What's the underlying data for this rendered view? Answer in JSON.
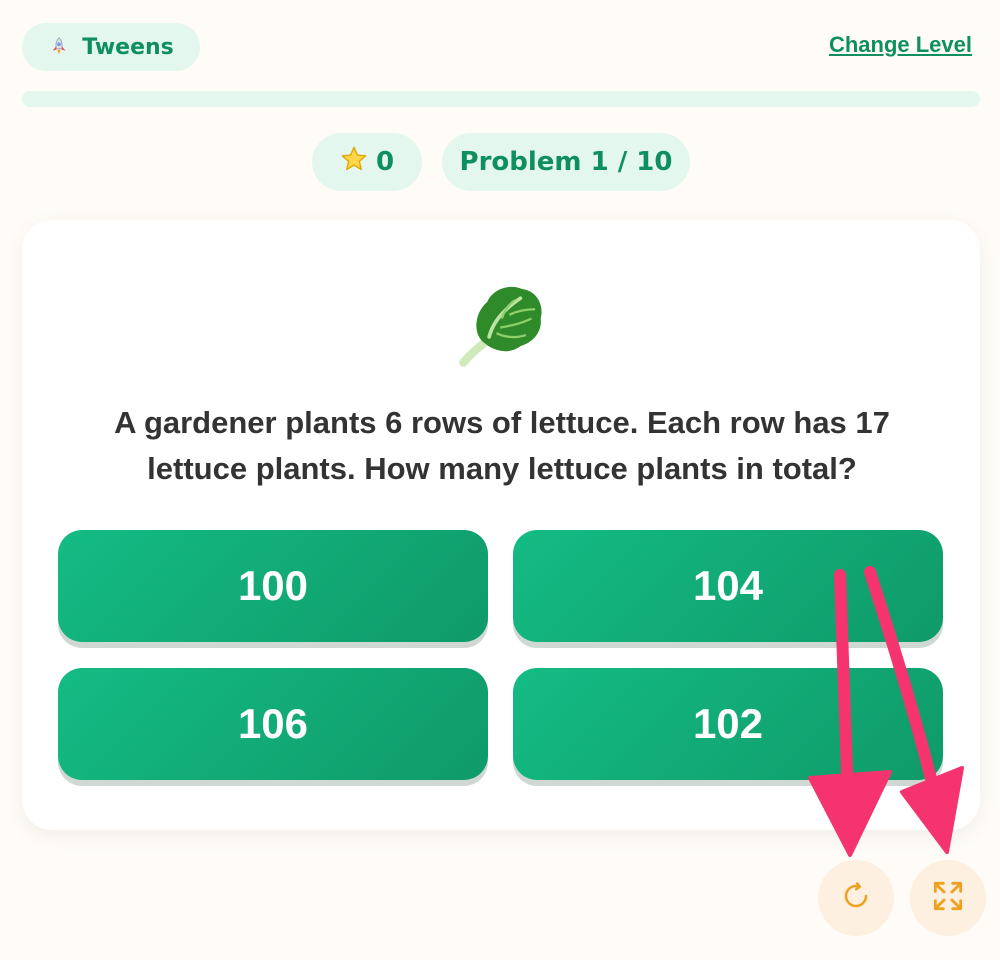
{
  "header": {
    "level_label": "Tweens",
    "level_icon": "rocket-icon",
    "change_level_label": "Change Level"
  },
  "progress": {
    "fraction": 0.0
  },
  "stats": {
    "stars_icon": "star-icon",
    "stars_count": "0",
    "problem_label": "Problem 1 / 10"
  },
  "question": {
    "image_icon": "lettuce-icon",
    "text": "A gardener plants 6 rows of lettuce. Each row has 17 lettuce plants. How many lettuce plants in total?"
  },
  "answers": [
    "100",
    "104",
    "106",
    "102"
  ],
  "controls": {
    "restart_icon": "restart-icon",
    "fullscreen_icon": "fullscreen-icon"
  },
  "colors": {
    "accent": "#13b07e",
    "pill_bg": "#e3f7ee",
    "control_icon": "#f0a020",
    "annotation_arrow": "#f5336f"
  }
}
